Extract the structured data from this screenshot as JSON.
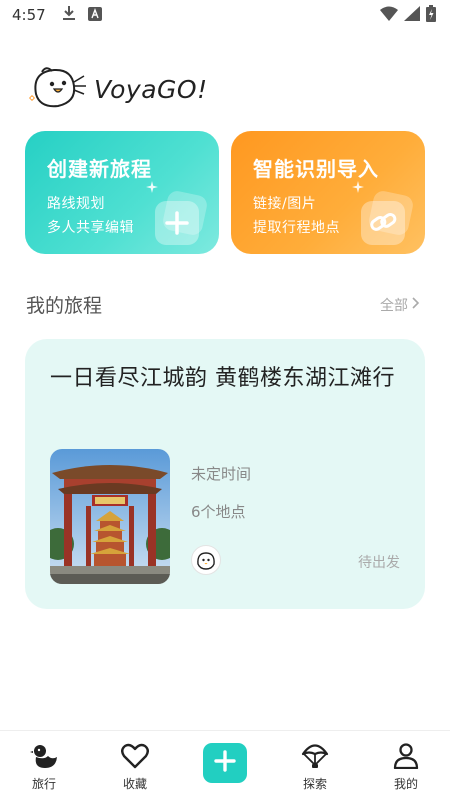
{
  "status_bar": {
    "time": "4:57",
    "icons_left": [
      "download-icon",
      "font-a-icon"
    ],
    "icons_right": [
      "wifi-icon",
      "signal-icon",
      "battery-icon"
    ]
  },
  "app": {
    "logo_text": "VoyaGO!"
  },
  "cards": {
    "create": {
      "title": "创建新旅程",
      "line1": "路线规划",
      "line2": "多人共享编辑",
      "icon": "plus-icon",
      "color": "#2ED3C6"
    },
    "import": {
      "title": "智能识别导入",
      "line1": "链接/图片",
      "line2": "提取行程地点",
      "icon": "link-icon",
      "color": "#FFA02A"
    }
  },
  "section": {
    "title": "我的旅程",
    "all_label": "全部"
  },
  "trip": {
    "title": "一日看尽江城韵 黄鹤楼东湖江滩行",
    "time": "未定时间",
    "places": "6个地点",
    "status": "待出发",
    "photo_caption": "黄鹤楼"
  },
  "nav": {
    "items": [
      {
        "label": "旅行",
        "icon": "duck-icon"
      },
      {
        "label": "收藏",
        "icon": "heart-icon"
      },
      {
        "label": "",
        "icon": "add-icon"
      },
      {
        "label": "探索",
        "icon": "parachute-icon"
      },
      {
        "label": "我的",
        "icon": "person-icon"
      }
    ],
    "accent": "#22CFC1"
  }
}
